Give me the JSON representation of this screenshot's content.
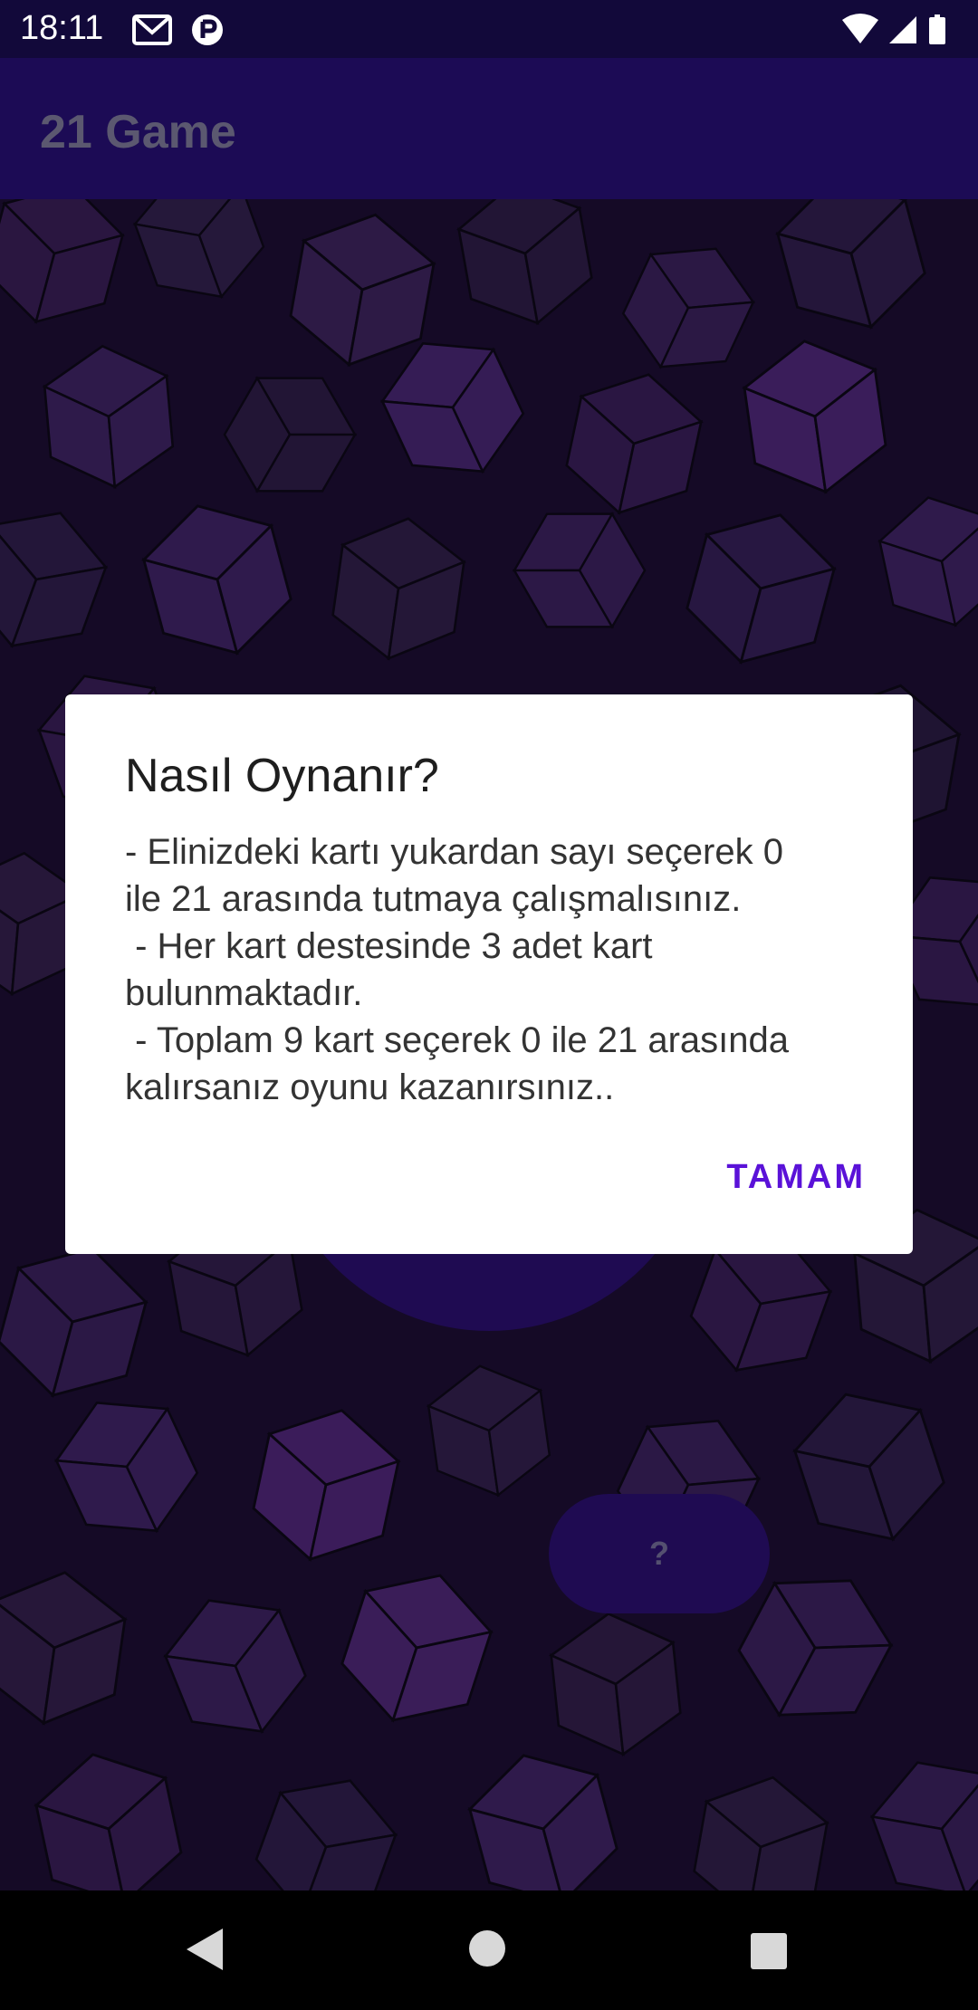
{
  "status_bar": {
    "time": "18:11",
    "left_icons": [
      "gmail-icon",
      "app-notification-icon"
    ],
    "right_icons": [
      "wifi-icon",
      "signal-icon",
      "battery-icon"
    ]
  },
  "app_bar": {
    "title": "21 Game"
  },
  "game": {
    "question_button_label": "?"
  },
  "dialog": {
    "title": "Nasıl Oynanır?",
    "body": "- Elinizdeki kartı yukardan sayı seçerek 0\nile 21 arasında tutmaya çalışmalısınız.\n - Her kart destesinde 3 adet kart\nbulunmaktadır.\n - Toplam 9 kart seçerek 0 ile 21 arasında\nkalırsanız oyunu kazanırsınız..",
    "ok_label": "TAMAM"
  },
  "nav_bar": {
    "icons": [
      "back-icon",
      "home-icon",
      "recents-icon"
    ]
  },
  "colors": {
    "status_bar": "#12093a",
    "app_bar": "#1c0b55",
    "accent": "#5a12d8",
    "background": "#150a26"
  }
}
